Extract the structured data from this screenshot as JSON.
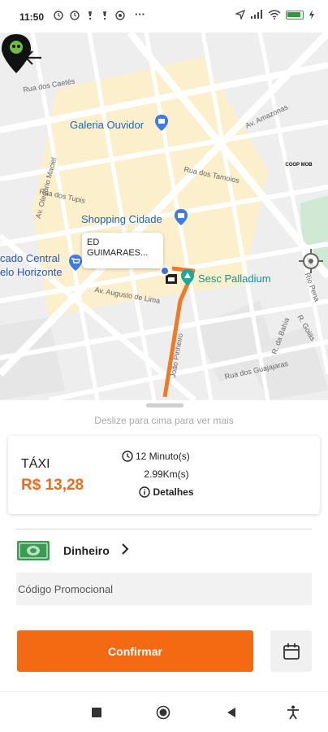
{
  "status_bar": {
    "time": "11:50",
    "left_icons": [
      "alarm-icon",
      "notification-icon",
      "notification-icon",
      "whatsapp-icon"
    ],
    "more": "···",
    "right_icons": [
      "location-icon",
      "signal-icon",
      "wifi-icon",
      "battery-icon",
      "charging-icon"
    ]
  },
  "map": {
    "places": {
      "galeria": "Galeria Ouvidor",
      "shopping": "Shopping Cidade",
      "mercado_line1": "cado Central",
      "mercado_line2": "elo Horizonte",
      "sesc": "Sesc Palladium"
    },
    "streets": {
      "caetes": "Rua dos Caetés",
      "amazonas": "Av. Amazonas",
      "oiapoque": "Av. Olegário Maciel",
      "tamoios": "Rua dos Tamoios",
      "tupis": "Rua dos Tupis",
      "augusto": "Av. Augusto de Lima",
      "bahia": "R. da Bahia",
      "goias": "R. Goiás",
      "guajajaras": "Rua dos Guajajaras",
      "joaopinheiro": "João Pinheiro",
      "rio_pena": "Rio Pena"
    },
    "callout_text": "ED GUIMARAES...",
    "coop_brand": "COOP MOB"
  },
  "sheet": {
    "hint": "Deslize para cima para ver mais",
    "ride": {
      "title": "TÁXI",
      "price": "R$ 13,28",
      "duration": "12 Minuto(s)",
      "distance": "2.99Km(s)",
      "details": "Detalhes"
    },
    "payment": {
      "label": "Dinheiro",
      "icon": "cash-icon"
    },
    "promo": {
      "placeholder": "Código Promocional"
    },
    "confirm_label": "Confirmar",
    "colors": {
      "accent": "#f36a12",
      "price": "#f06a1e",
      "route": "#f07a23"
    }
  },
  "nav": {
    "icons": [
      "recents-icon",
      "home-icon",
      "back-icon",
      "accessibility-icon"
    ]
  }
}
